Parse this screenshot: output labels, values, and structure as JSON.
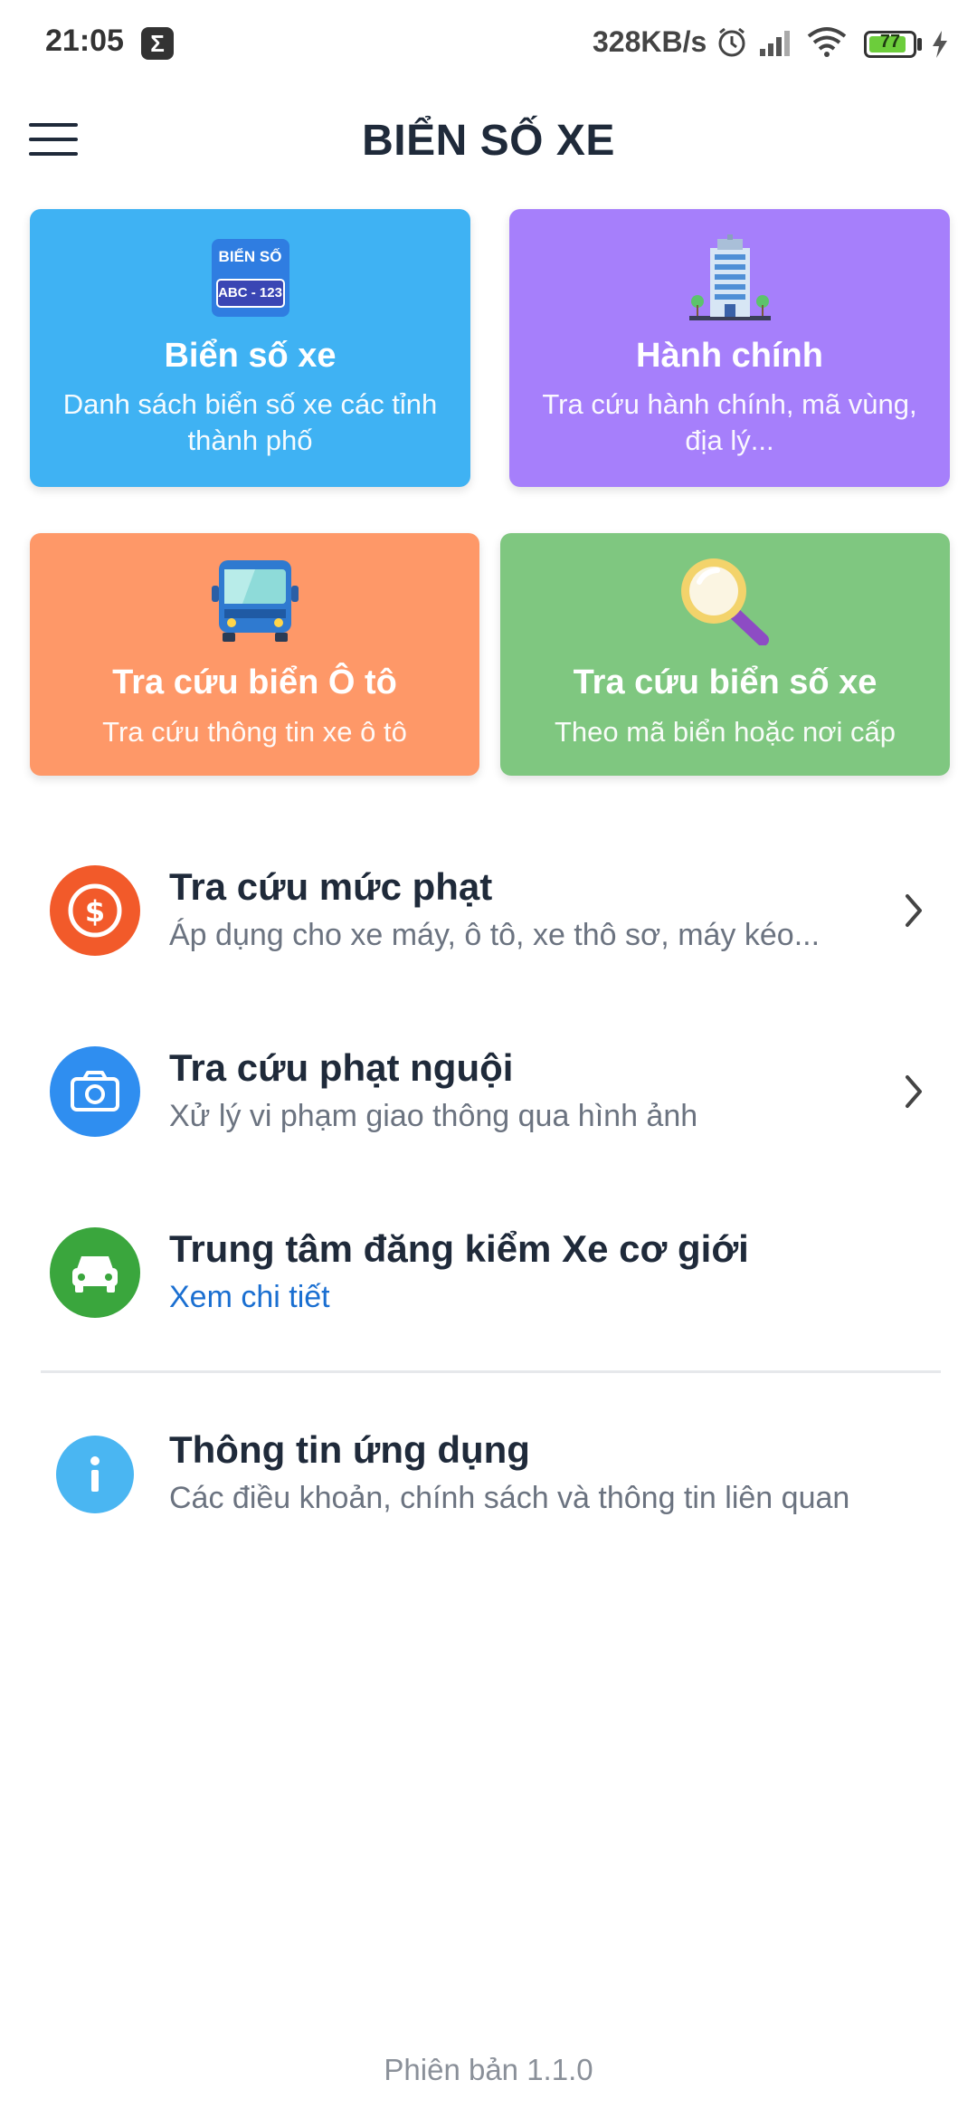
{
  "status_bar": {
    "time": "21:05",
    "notification_icon": "sigma-icon",
    "network_speed": "328KB/s",
    "icons": [
      "alarm-icon",
      "signal-icon",
      "wifi-icon",
      "battery-icon",
      "charging-icon"
    ],
    "battery_level": "77"
  },
  "header": {
    "title": "BIỂN SỐ XE",
    "menu_icon": "hamburger-menu-icon"
  },
  "cards": [
    {
      "title": "Biển số xe",
      "subtitle": "Danh sách biển số xe các tỉnh thành phố",
      "color": "#3fb2f3",
      "icon": "license-plate-icon",
      "plate_top": "BIỂN SỐ",
      "plate_bottom": "ABC - 123"
    },
    {
      "title": "Hành chính",
      "subtitle": "Tra cứu hành chính, mã vùng, địa lý...",
      "color": "#a67ffb",
      "icon": "building-icon"
    },
    {
      "title": "Tra cứu biển Ô tô",
      "subtitle": "Tra cứu thông tin xe ô tô",
      "color": "#fe9868",
      "icon": "bus-icon"
    },
    {
      "title": "Tra cứu biển số xe",
      "subtitle": "Theo mã biển hoặc nơi cấp",
      "color": "#7fc780",
      "icon": "magnifier-icon"
    }
  ],
  "list": [
    {
      "title": "Tra cứu mức phạt",
      "subtitle": "Áp dụng cho xe máy, ô tô, xe thô sơ, máy kéo...",
      "icon": "dollar-icon",
      "icon_color": "#f25a2a"
    },
    {
      "title": "Tra cứu phạt nguội",
      "subtitle": "Xử lý vi phạm giao thông qua hình ảnh",
      "icon": "camera-icon",
      "icon_color": "#2f8ef0"
    },
    {
      "title": "Trung tâm đăng kiểm Xe cơ giới",
      "subtitle": "Xem chi tiết",
      "icon": "car-icon",
      "icon_color": "#3aa63d"
    },
    {
      "title": "Thông tin ứng dụng",
      "subtitle": "Các điều khoản, chính sách và thông tin liên quan",
      "icon": "info-icon",
      "icon_color": "#4ab6f2"
    }
  ],
  "footer": {
    "version": "Phiên bản 1.1.0"
  }
}
